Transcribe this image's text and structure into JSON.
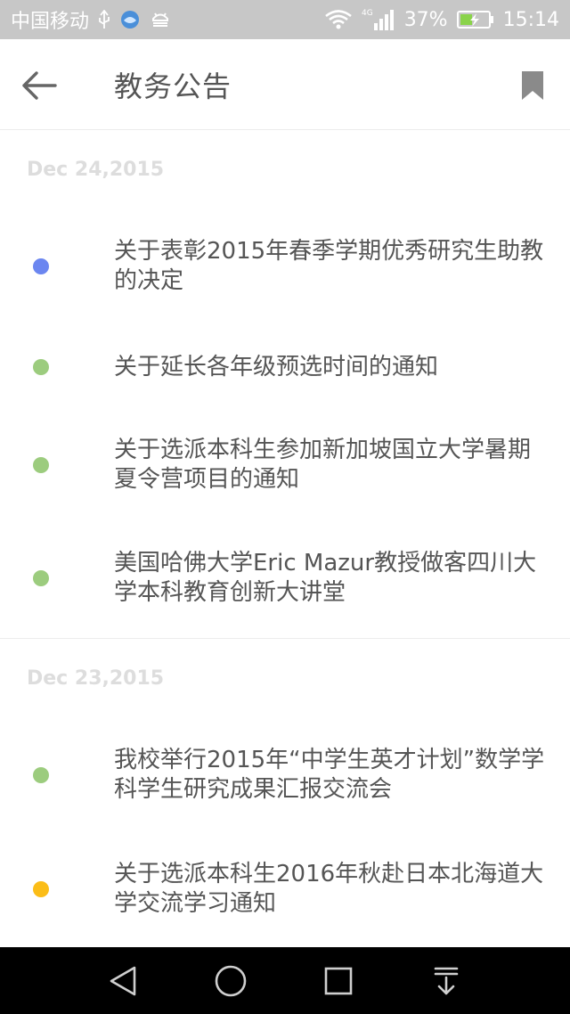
{
  "status_bar": {
    "carrier": "中国移动",
    "network": "4G",
    "battery": "37%",
    "time": "15:14",
    "icons": [
      "usb-icon",
      "app-notification-icon",
      "android-debug-icon",
      "wifi-icon",
      "signal-icon",
      "battery-charging-icon"
    ]
  },
  "header": {
    "title": "教务公告",
    "back_icon": "arrow-left-icon",
    "bookmark_icon": "bookmark-icon"
  },
  "colors": {
    "blue_dot": "#6b86f0",
    "green_dot": "#9ccc7e",
    "yellow_dot": "#fbbd18",
    "text": "#555555",
    "date": "#dddddd",
    "status_bar": "#c7c7c7"
  },
  "sections": [
    {
      "date": "Dec 24,2015",
      "items": [
        {
          "title": "关于表彰2015年春季学期优秀研究生助教的决定",
          "dot_color": "#6b86f0"
        },
        {
          "title": "关于延长各年级预选时间的通知",
          "dot_color": "#9ccc7e"
        },
        {
          "title": "关于选派本科生参加新加坡国立大学暑期夏令营项目的通知",
          "dot_color": "#9ccc7e"
        },
        {
          "title": "美国哈佛大学Eric Mazur教授做客四川大学本科教育创新大讲堂",
          "dot_color": "#9ccc7e"
        }
      ]
    },
    {
      "date": "Dec 23,2015",
      "items": [
        {
          "title": "我校举行2015年“中学生英才计划”数学学科学生研究成果汇报交流会",
          "dot_color": "#9ccc7e"
        },
        {
          "title": "关于选派本科生2016年秋赴日本北海道大学交流学习通知",
          "dot_color": "#fbbd18"
        }
      ]
    }
  ],
  "nav_bar": {
    "icons": [
      "back-triangle-icon",
      "home-circle-icon",
      "recents-square-icon",
      "notification-pull-icon"
    ]
  }
}
